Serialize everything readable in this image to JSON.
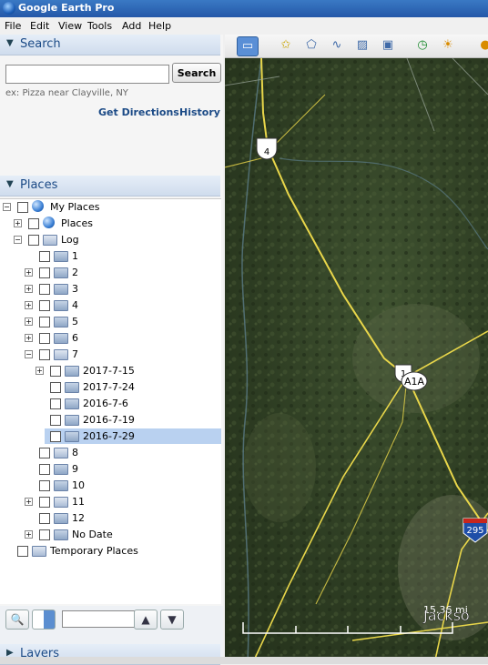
{
  "app": {
    "title": "Google Earth Pro"
  },
  "menu": [
    "File",
    "Edit",
    "View",
    "Tools",
    "Add",
    "Help"
  ],
  "search": {
    "header": "Search",
    "input_value": "",
    "button": "Search",
    "hint": "ex: Pizza near Clayville, NY",
    "get_directions": "Get Directions",
    "history": "History"
  },
  "places": {
    "header": "Places",
    "tree": [
      {
        "label": "My Places"
      },
      {
        "label": "Places"
      },
      {
        "label": "Log"
      },
      {
        "label": "1"
      },
      {
        "label": "2"
      },
      {
        "label": "3"
      },
      {
        "label": "4"
      },
      {
        "label": "5"
      },
      {
        "label": "6"
      },
      {
        "label": "7"
      },
      {
        "label": "2017-7-15"
      },
      {
        "label": "2017-7-24"
      },
      {
        "label": "2016-7-6"
      },
      {
        "label": "2016-7-19"
      },
      {
        "label": "2016-7-29"
      },
      {
        "label": "8"
      },
      {
        "label": "9"
      },
      {
        "label": "10"
      },
      {
        "label": "11"
      },
      {
        "label": "12"
      },
      {
        "label": "No Date"
      },
      {
        "label": "Temporary Places"
      }
    ]
  },
  "layers": {
    "header": "Layers"
  },
  "map": {
    "route_labels": [
      "4",
      "1",
      "A1A",
      "295"
    ],
    "scale_label": "15.36 mi",
    "city_label": "Jackso"
  }
}
